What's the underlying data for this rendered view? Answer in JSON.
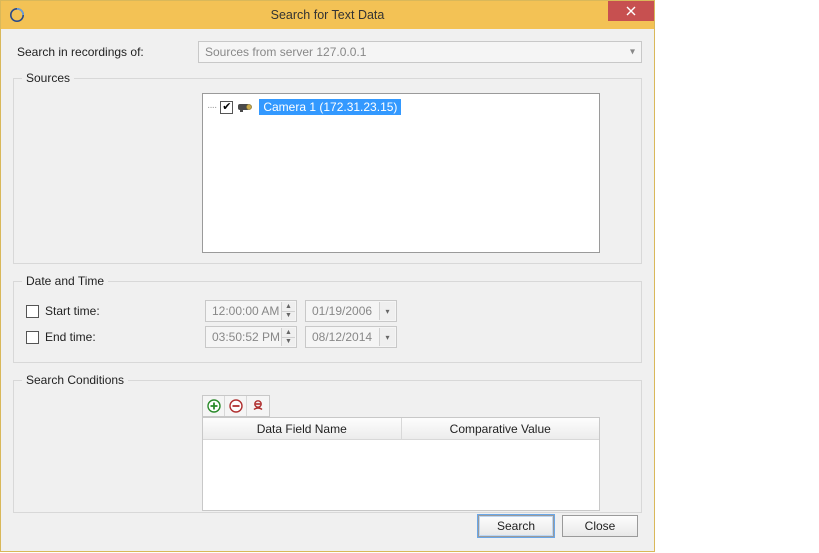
{
  "window": {
    "title": "Search for Text Data"
  },
  "searchIn": {
    "label": "Search in recordings of:",
    "value": "Sources from server 127.0.0.1"
  },
  "sources": {
    "legend": "Sources",
    "item": {
      "checked": true,
      "label": "Camera 1 (172.31.23.15)"
    }
  },
  "dateTime": {
    "legend": "Date and Time",
    "start": {
      "label": "Start time:",
      "time": "12:00:00 AM",
      "date": "01/19/2006"
    },
    "end": {
      "label": "End time:",
      "time": "03:50:52 PM",
      "date": "08/12/2014"
    }
  },
  "conditions": {
    "legend": "Search Conditions",
    "columns": {
      "field": "Data Field Name",
      "value": "Comparative Value"
    }
  },
  "buttons": {
    "search": "Search",
    "close": "Close"
  }
}
